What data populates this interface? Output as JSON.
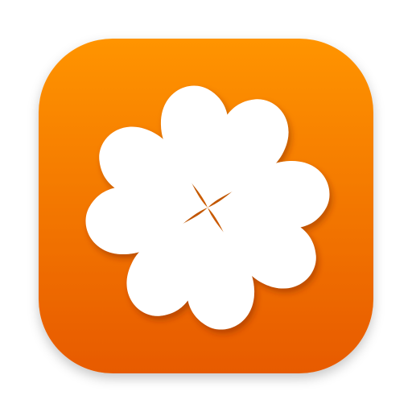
{
  "app_icon": {
    "icon": "four-leaf-clover-icon",
    "colors": {
      "gradient_top": "#FF9405",
      "gradient_bottom": "#E75A05",
      "clover": "#FFFFFF",
      "shadow": "#7A2800"
    }
  }
}
